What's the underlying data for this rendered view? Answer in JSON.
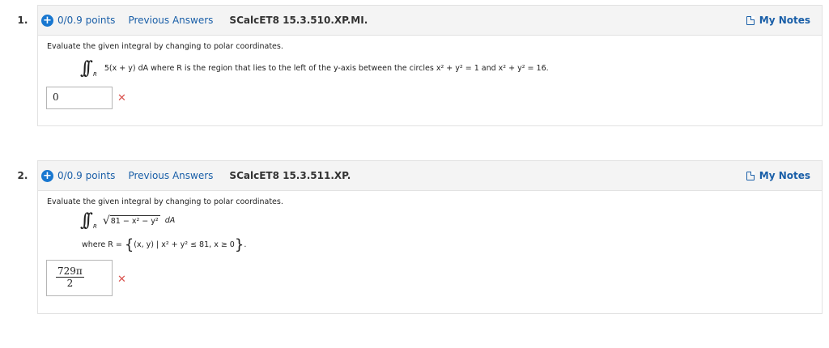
{
  "questions": [
    {
      "number": "1.",
      "points": "0/0.9 points",
      "previous_answers": "Previous Answers",
      "code": "SCalcET8 15.3.510.XP.MI.",
      "my_notes": "My Notes",
      "prompt": "Evaluate the given integral by changing to polar coordinates.",
      "integrand": "5(x + y) dA where R is the region that lies to the left of the y-axis between the circles x² + y² = 1 and x² + y² = 16.",
      "answer": "0",
      "status": "incorrect"
    },
    {
      "number": "2.",
      "points": "0/0.9 points",
      "previous_answers": "Previous Answers",
      "code": "SCalcET8 15.3.511.XP.",
      "my_notes": "My Notes",
      "prompt": "Evaluate the given integral by changing to polar coordinates.",
      "integrand_radicand": "81 − x² − y²",
      "integrand_suffix": "dA",
      "region_label": "where R =",
      "region_set": "(x, y) | x² + y² ≤ 81, x ≥ 0",
      "answer_numerator": "729π",
      "answer_denominator": "2",
      "status": "incorrect"
    }
  ],
  "icons": {
    "expand": "plus-circle-icon",
    "notes": "notes-icon",
    "incorrect": "x-mark-icon"
  },
  "colors": {
    "link": "#1a5fa8",
    "plus": "#1877d0",
    "incorrect": "#d9534f",
    "header_bg": "#f4f4f4"
  }
}
